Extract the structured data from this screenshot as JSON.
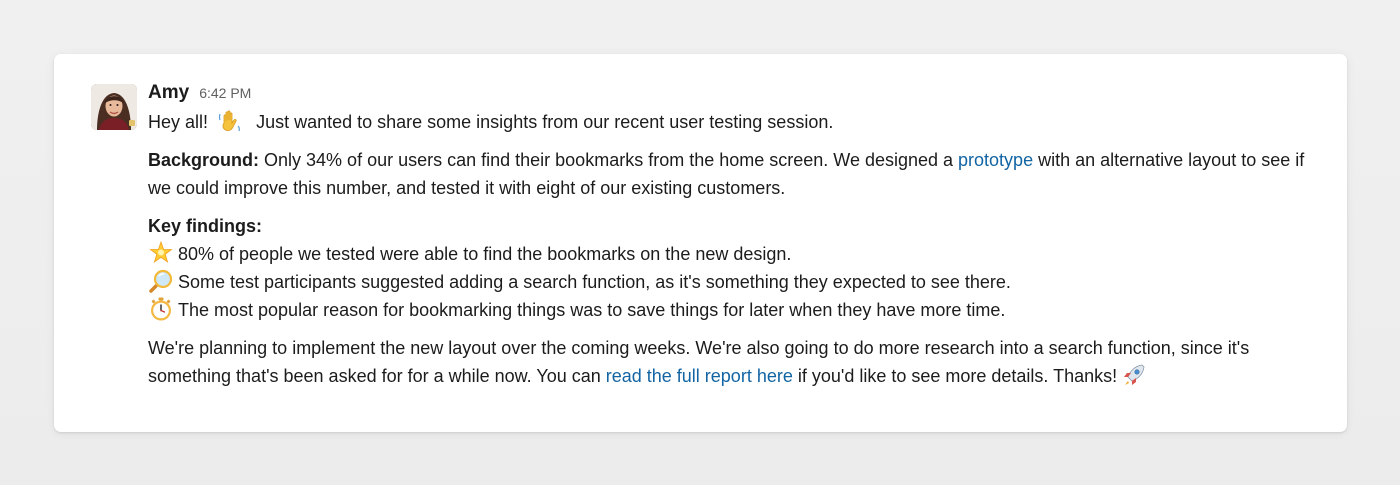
{
  "message": {
    "author": "Amy",
    "time": "6:42 PM",
    "greeting": "Hey all!",
    "intro": "Just wanted to share some insights from our recent user testing session.",
    "background_label": "Background:",
    "background_text_before": " Only 34% of our users can find their bookmarks from the home screen. We designed a ",
    "background_link": "prototype",
    "background_text_after": " with an alternative layout to see if we could improve this number, and tested it with eight of our existing customers.",
    "findings_heading": "Key findings:",
    "findings": [
      {
        "icon": "glowing-star-emoji",
        "text": "80% of people we tested were able to find the bookmarks on the new design."
      },
      {
        "icon": "magnifying-glass-emoji",
        "text": "Some test participants suggested adding a search function, as it's something they expected to see there."
      },
      {
        "icon": "stopwatch-emoji",
        "text": "The most popular reason for bookmarking things was to save things for later when they have more time."
      }
    ],
    "closing_before": "We're planning to implement the new layout over the coming weeks. We're also going to do more research into a search function, since it's something that's been asked for for a while now. You can ",
    "closing_link": "read the full report here",
    "closing_after": " if you'd like to see more details. Thanks!",
    "greeting_emoji": "waving-hand-emoji",
    "closing_emoji": "rocket-emoji"
  },
  "colors": {
    "link": "#1264a3",
    "text": "#1d1c1d",
    "timestamp": "#616061",
    "card_background": "#ffffff",
    "page_background": "#efefef"
  }
}
